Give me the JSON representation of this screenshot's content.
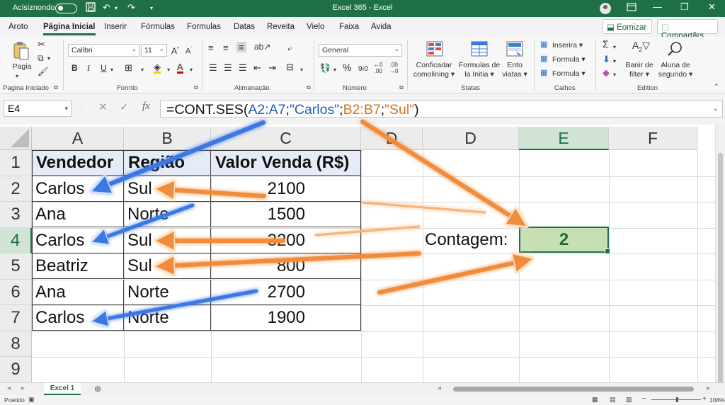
{
  "titlebar": {
    "autosave_label": "Acisiznondo",
    "title": "Excel 365  -  Excel",
    "minimize_glyph": "—",
    "maximize_glyph": "❐",
    "close_glyph": "✕"
  },
  "menu": {
    "tabs": [
      "Aroto",
      "Página Inicial",
      "Inserir",
      "Fórmulas",
      "Formulas",
      "Datas",
      "Reveita",
      "Vielo",
      "Faixa",
      "Avida"
    ],
    "active_tab": "Página Inicial",
    "share_feature_label": "Eomizar",
    "share_label": "Compartãrs"
  },
  "ribbon": {
    "paste_label": "Pagia",
    "font_name": "Callbri",
    "font_size": "11",
    "number_format": "General",
    "conditional_label_1": "Conficadar",
    "conditional_label_2": "comolining",
    "formulas_label_1": "Formulas de",
    "formulas_label_2": "la Initia",
    "into_label_1": "Ento",
    "into_label_2": "viatas",
    "insert_label": "Inserira",
    "format_label": "Formula",
    "format_label_2": "Formula",
    "sort_label_1": "Banir de",
    "sort_label_2": "filter",
    "find_label_1": "Aluna de",
    "find_label_2": "segundo",
    "percent_glyph": "%",
    "thousand_glyph": "9ı0",
    "groups": {
      "clipboard": "Pagina Iniciado",
      "font": "Formlo",
      "alignment": "Alimenação",
      "number": "Número",
      "styles": "Statas",
      "cells": "Calhos",
      "editing": "Edition"
    }
  },
  "formula_bar": {
    "name_box": "E4",
    "fx": "fx",
    "prefix": "=CONT.SES(",
    "range1": "A2:A7",
    "sep1": ";",
    "crit1": "\"Carlos\"",
    "sep2": ";",
    "range2": "B2:B7",
    "sep3": ";",
    "crit2": "\"Sul\"",
    "suffix": ")",
    "colors": {
      "range1": "#1f5fb0",
      "range2": "#d4731c",
      "text": "#111111"
    }
  },
  "grid": {
    "columns": [
      "A",
      "B",
      "C",
      "D",
      "D",
      "E",
      "F"
    ],
    "selected_column": "E",
    "rows": [
      "1",
      "2",
      "3",
      "4",
      "5",
      "6",
      "7",
      "8",
      "9"
    ],
    "selected_row": "4",
    "table_header": [
      "Vendedor",
      "Região",
      "Valor Venda (R$)"
    ],
    "table_rows": [
      [
        "Carlos",
        "Sul",
        "2100"
      ],
      [
        "Ana",
        "Norte",
        "1500"
      ],
      [
        "Carlos",
        "Sul",
        "3200"
      ],
      [
        "Beatriz",
        "Sul",
        "800"
      ],
      [
        "Ana",
        "Norte",
        "2700"
      ],
      [
        "Carlos",
        "Norte",
        "1900"
      ]
    ],
    "result_label": "Contagem:",
    "result_value": "2",
    "selected_cell_fill": "#c6e0b4",
    "accent": "#1f7145"
  },
  "sheets": {
    "tabs": [
      "Excel 1"
    ],
    "active": "Excel 1"
  },
  "status": {
    "left": "Poetido",
    "zoom": "108%"
  }
}
